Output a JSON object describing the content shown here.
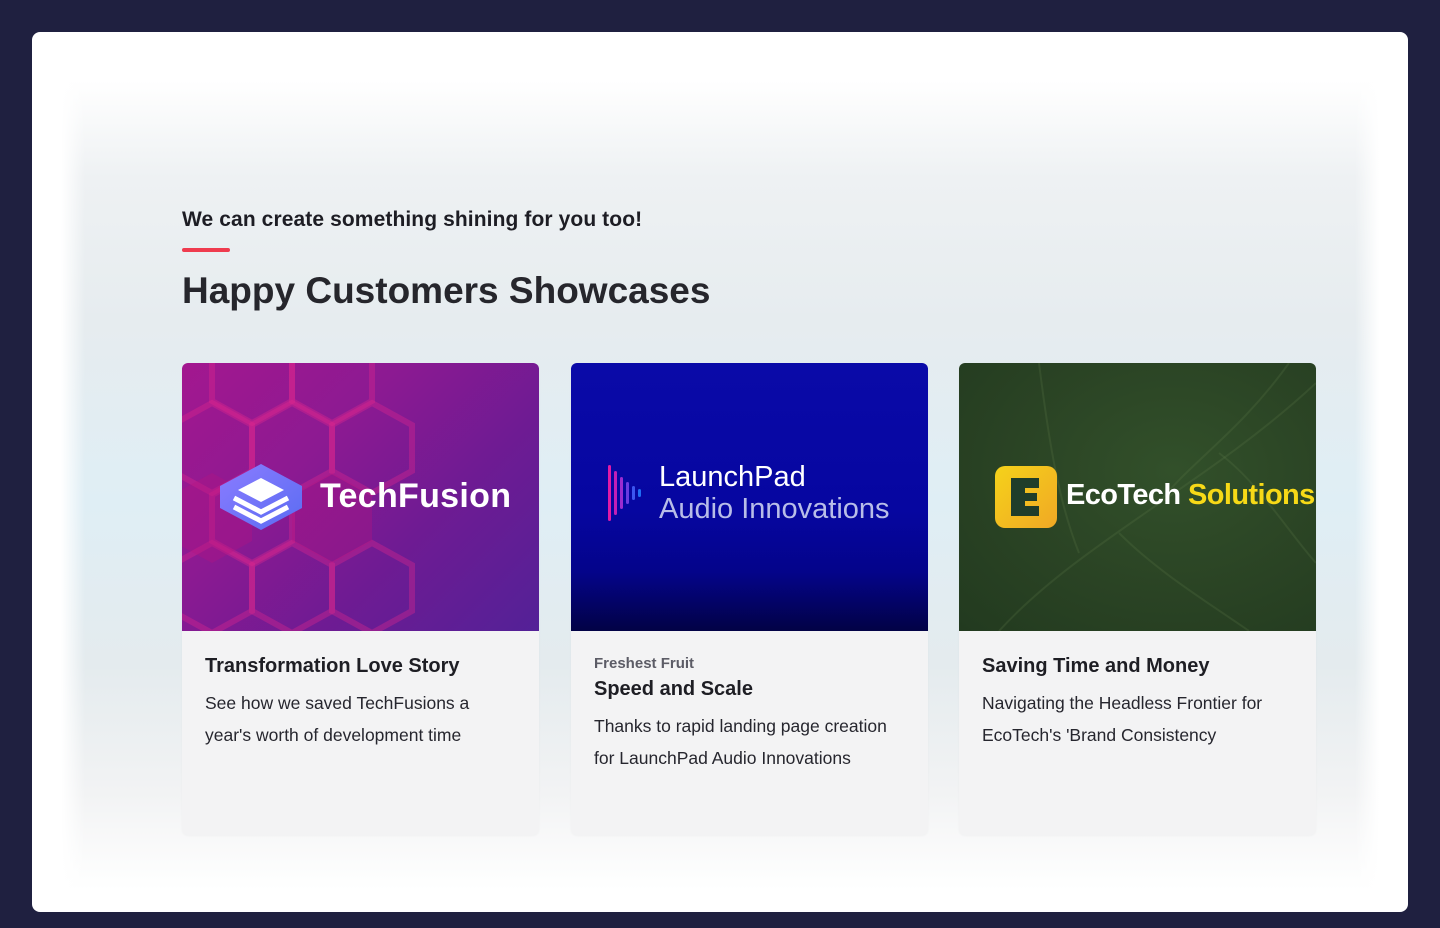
{
  "section": {
    "eyebrow": "We can create something shining for you too!",
    "heading": "Happy Customers Showcases"
  },
  "cards": [
    {
      "brand": "TechFusion",
      "kicker": "",
      "title": "Transformation Love Story",
      "description": "See how we saved TechFusions a year's worth of development time"
    },
    {
      "brand_line1": "LaunchPad",
      "brand_line2": "Audio Innovations",
      "kicker": "Freshest Fruit",
      "title": "Speed and Scale",
      "description": "Thanks to rapid landing page creation for LaunchPad Audio Innovations"
    },
    {
      "brand_part1": "EcoTech",
      "brand_part2": "Solutions",
      "kicker": "",
      "title": "Saving Time and Money",
      "description": "Navigating the Headless Frontier for EcoTech's 'Brand Consistency"
    }
  ],
  "colors": {
    "accent": "#ef3b4e",
    "page_background": "#1f2040",
    "techfusion_gradient": [
      "#a3178f",
      "#532197"
    ],
    "launchpad_blue": "#0606a0",
    "ecotech_green": "#2a4324",
    "ecotech_yellow": "#f7d917"
  },
  "icons": [
    "techfusion-logo-icon",
    "launchpad-waveform-icon",
    "ecotech-logo-icon"
  ]
}
